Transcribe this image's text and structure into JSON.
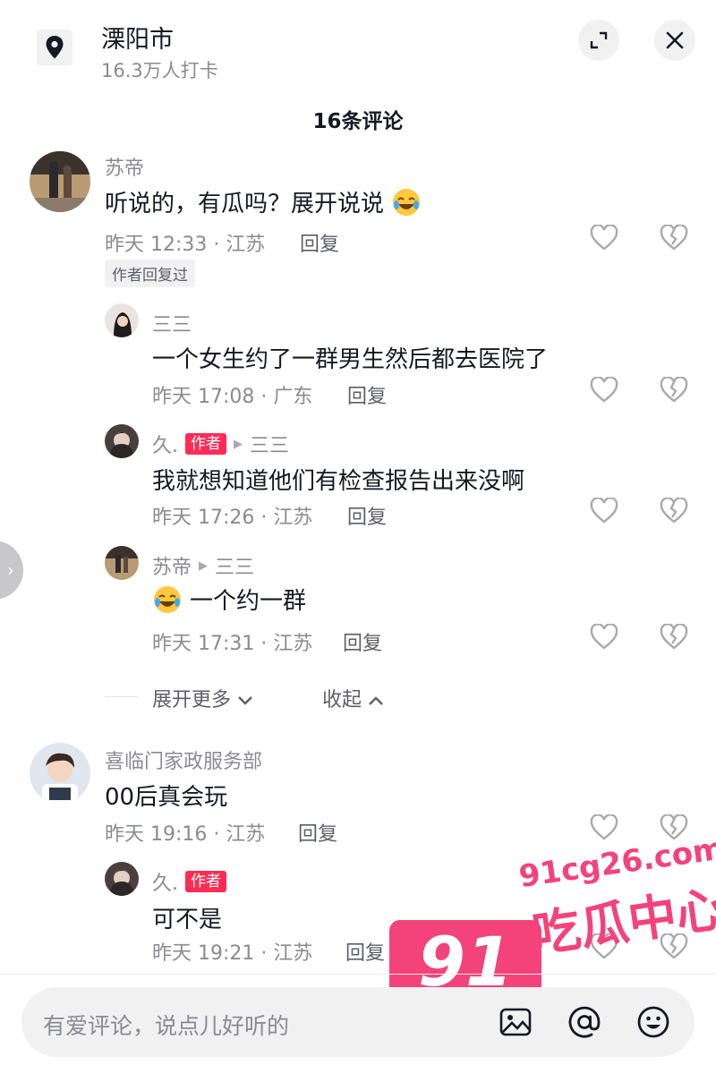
{
  "header": {
    "location_title": "溧阳市",
    "checkins": "16.3万人打卡",
    "icons": [
      "location-pin-icon",
      "collapse-icon",
      "close-icon"
    ]
  },
  "comments_count": "16条评论",
  "comments": [
    {
      "user": "苏帝",
      "text": "听说的，有瓜吗？展开说说",
      "emoji": "laugh-cry",
      "time_loc": "昨天 12:33 · 江苏",
      "reply_label": "回复",
      "badge": "作者回复过"
    },
    {
      "user": "三三",
      "text": "一个女生约了一群男生然后都去医院了",
      "time_loc": "昨天 17:08 · 广东",
      "reply_label": "回复"
    },
    {
      "user": "久.",
      "author_tag": "作者",
      "reply_to": "三三",
      "text": "我就想知道他们有检查报告出来没啊",
      "time_loc": "昨天 17:26 · 江苏",
      "reply_label": "回复"
    },
    {
      "user": "苏帝",
      "reply_to": "三三",
      "text": "一个约一群",
      "emoji": "laugh-cry",
      "time_loc": "昨天 17:31 · 江苏",
      "reply_label": "回复"
    },
    {
      "user": "喜临门家政服务部",
      "text": "00后真会玩",
      "time_loc": "昨天 19:16 · 江苏",
      "reply_label": "回复"
    },
    {
      "user": "久.",
      "author_tag": "作者",
      "text": "可不是",
      "time_loc": "昨天 19:21 · 江苏",
      "reply_label": "回复"
    }
  ],
  "thread_controls": {
    "expand_more": "展开更多",
    "collapse": "收起"
  },
  "footer": {
    "input_placeholder": "有爱评论，说点儿好听的",
    "icons": [
      "image-icon",
      "at-icon",
      "emoji-icon"
    ]
  },
  "watermark": {
    "badge": "91",
    "site": "91cg26.com",
    "name": "吃瓜中心"
  },
  "colors": {
    "author_tag": "#fe2c55",
    "watermark": "#f4427a",
    "secondary_text": "#8a8b91"
  }
}
